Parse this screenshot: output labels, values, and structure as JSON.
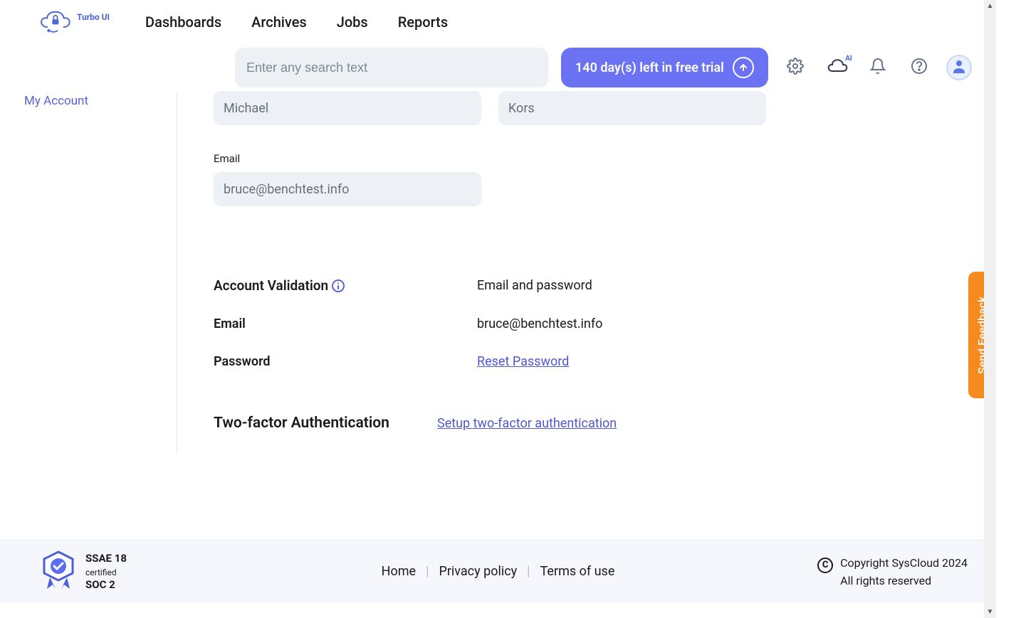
{
  "brand": {
    "name": "Turbo UI"
  },
  "nav": {
    "items": [
      {
        "label": "Dashboards"
      },
      {
        "label": "Archives"
      },
      {
        "label": "Jobs"
      },
      {
        "label": "Reports"
      }
    ]
  },
  "toolbar": {
    "search_placeholder": "Enter any search text",
    "trial_text": "140 day(s) left in free trial",
    "cloud_badge": "AI"
  },
  "sidebar": {
    "items": [
      {
        "label": "My Account"
      }
    ]
  },
  "form": {
    "first_name": "Michael",
    "last_name": "Kors",
    "email_label": "Email",
    "email_value": "bruce@benchtest.info"
  },
  "account_validation": {
    "heading": "Account Validation",
    "method": "Email and password",
    "email_label": "Email",
    "email_value": "bruce@benchtest.info",
    "password_label": "Password",
    "reset_link": "Reset Password"
  },
  "tfa": {
    "heading": "Two-factor Authentication",
    "setup_link": "Setup two-factor authentication"
  },
  "feedback": {
    "label": "Send Feedback"
  },
  "footer": {
    "badge_line1": "SSAE 18",
    "badge_line2": "certified",
    "badge_line3": "SOC 2",
    "links": {
      "home": "Home",
      "privacy": "Privacy policy",
      "terms": "Terms of use"
    },
    "copyright_line1": "Copyright SysCloud 2024",
    "copyright_line2": "All rights reserved"
  }
}
